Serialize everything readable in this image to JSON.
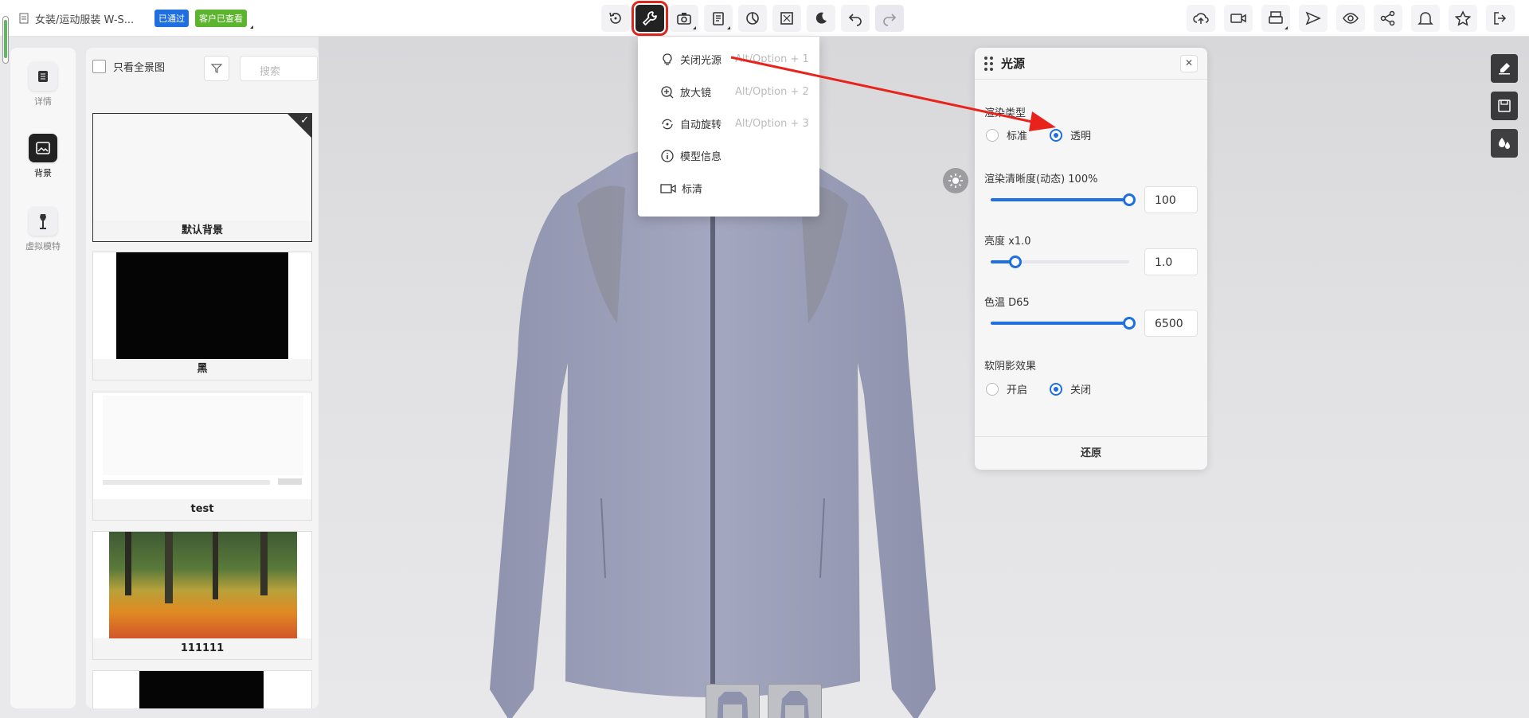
{
  "header": {
    "title": "女装/运动服装 W-S...",
    "badge_passed": "已通过",
    "badge_viewed": "客户已查看"
  },
  "toolbar": {
    "icons": [
      "reset-view-icon",
      "wrench-icon",
      "camera-icon",
      "document-icon",
      "pie-icon",
      "fit-screen-icon",
      "moon-icon",
      "undo-icon",
      "redo-icon"
    ],
    "right_icons": [
      "cloud-upload-icon",
      "video-icon",
      "printer-icon",
      "send-icon",
      "eye-icon",
      "share-icon",
      "bell-icon",
      "star-icon",
      "exit-icon"
    ]
  },
  "sidenav": {
    "items": [
      {
        "label": "详情",
        "icon": "document-icon"
      },
      {
        "label": "背景",
        "icon": "image-icon"
      },
      {
        "label": "虚拟模特",
        "icon": "mannequin-icon"
      }
    ]
  },
  "background_panel": {
    "checkbox_label": "只看全景图",
    "search_placeholder": "搜索",
    "cards": [
      {
        "caption": "默认背景",
        "selected": true
      },
      {
        "caption": "黑"
      },
      {
        "caption": "test"
      },
      {
        "caption": "111111"
      }
    ]
  },
  "tool_menu": {
    "items": [
      {
        "label": "关闭光源",
        "shortcut": "Alt/Option + 1"
      },
      {
        "label": "放大镜",
        "shortcut": "Alt/Option + 2"
      },
      {
        "label": "自动旋转",
        "shortcut": "Alt/Option + 3"
      },
      {
        "label": "模型信息",
        "shortcut": ""
      },
      {
        "label": "标清",
        "shortcut": ""
      }
    ]
  },
  "light_panel": {
    "title": "光源",
    "render_type_label": "渲染类型",
    "render_options": [
      "标准",
      "透明"
    ],
    "render_selected": "透明",
    "clarity_label": "渲染清晰度(动态) 100%",
    "clarity_value": "100",
    "clarity_fraction": 1.0,
    "brightness_label": "亮度 x1.0",
    "brightness_value": "1.0",
    "brightness_fraction": 0.18,
    "temp_label": "色温 D65",
    "temp_value": "6500",
    "temp_fraction": 1.0,
    "shadow_label": "软阴影效果",
    "shadow_options": [
      "开启",
      "关闭"
    ],
    "shadow_selected": "关闭",
    "reset_label": "还原"
  },
  "colors": {
    "accent": "#1f6fe0",
    "badge_green": "#5db42f",
    "highlight_red": "#e0251f",
    "garment": "#9ea2bd"
  }
}
